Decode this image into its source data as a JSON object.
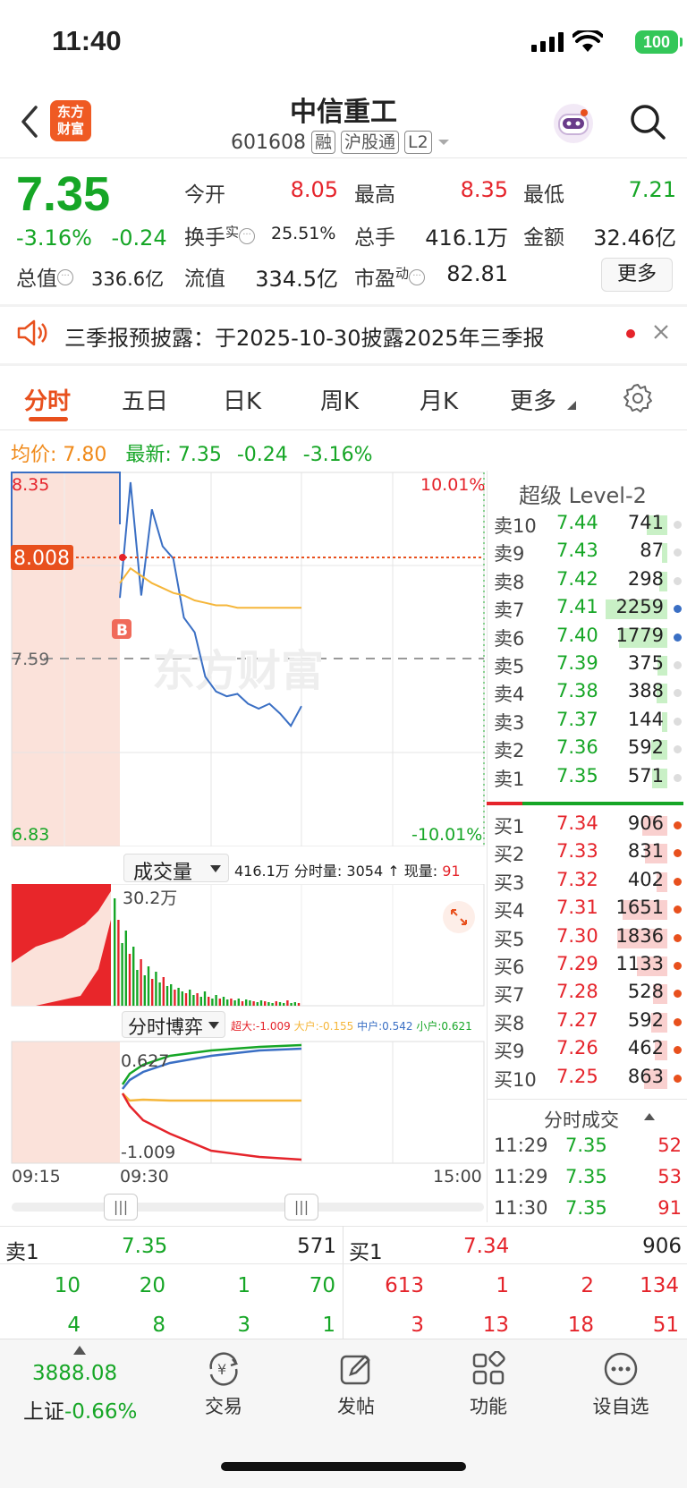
{
  "status": {
    "time": "11:40",
    "battery": "100"
  },
  "header": {
    "logo": "东方\n财富",
    "title": "中信重工",
    "code": "601608",
    "tags": [
      "融",
      "沪股通",
      "L2"
    ]
  },
  "quote": {
    "price": "7.35",
    "change_pct": "-3.16%",
    "change": "-0.24",
    "open_label": "今开",
    "open": "8.05",
    "high_label": "最高",
    "high": "8.35",
    "low_label": "最低",
    "low": "7.21",
    "turnover_label": "换手",
    "turnover_sup": "实",
    "turnover": "25.51%",
    "volume_label": "总手",
    "volume": "416.1万",
    "amount_label": "金额",
    "amount": "32.46亿",
    "mktcap_label": "总值",
    "mktcap": "336.6亿",
    "float_label": "流值",
    "float": "334.5亿",
    "pe_label": "市盈",
    "pe_sup": "动",
    "pe": "82.81",
    "more": "更多"
  },
  "notice": {
    "text": "三季报预披露：于2025-10-30披露2025年三季报"
  },
  "tabs": [
    "分时",
    "五日",
    "日K",
    "周K",
    "月K",
    "更多"
  ],
  "chart_info": {
    "avg_label": "均价:",
    "avg": "7.80",
    "latest_label": "最新:",
    "latest": "7.35",
    "chg": "-0.24",
    "pct": "-3.16%"
  },
  "chart_data": {
    "type": "line",
    "title": "",
    "y_left_ticks": [
      "8.35",
      "7.59",
      "6.83"
    ],
    "y_right_ticks": [
      "10.01%",
      "-10.01%"
    ],
    "crosshair_price": "8.008",
    "marker": "B",
    "x_ticks": [
      "09:15",
      "09:30",
      "15:00"
    ],
    "watermark": "东方财富",
    "series": [
      {
        "color": "#3a6fc4",
        "values": [
          7.84,
          8.31,
          7.85,
          8.2,
          8.05,
          8.0,
          7.76,
          7.7,
          7.52,
          7.46,
          7.44,
          7.45,
          7.41,
          7.39,
          7.41,
          7.37,
          7.32,
          7.4
        ]
      },
      {
        "color": "#f5b63a",
        "values": [
          7.9,
          7.96,
          7.93,
          7.9,
          7.88,
          7.86,
          7.85,
          7.83,
          7.82,
          7.81,
          7.81,
          7.8,
          7.8,
          7.8,
          7.8,
          7.8,
          7.8,
          7.8
        ]
      }
    ]
  },
  "volume_panel": {
    "label": "成交量",
    "total": "416.1万",
    "tick_label": "分时量:",
    "tick_vol": "3054",
    "now_label": "现量:",
    "now": "91",
    "max_label": "30.2万"
  },
  "game_panel": {
    "label": "分时博弈",
    "big_label": "超大:",
    "big": "-1.009",
    "large_label": "大户:",
    "large": "-0.155",
    "mid_label": "中户:",
    "mid": "0.542",
    "small_label": "小户:",
    "small": "0.621",
    "top_val": "0.627",
    "bot_val": "-1.009"
  },
  "level2": {
    "title": "超级 Level-2",
    "asks": [
      {
        "label": "卖10",
        "price": "7.44",
        "vol": "741"
      },
      {
        "label": "卖9",
        "price": "7.43",
        "vol": "87"
      },
      {
        "label": "卖8",
        "price": "7.42",
        "vol": "298"
      },
      {
        "label": "卖7",
        "price": "7.41",
        "vol": "2259"
      },
      {
        "label": "卖6",
        "price": "7.40",
        "vol": "1779"
      },
      {
        "label": "卖5",
        "price": "7.39",
        "vol": "375"
      },
      {
        "label": "卖4",
        "price": "7.38",
        "vol": "388"
      },
      {
        "label": "卖3",
        "price": "7.37",
        "vol": "144"
      },
      {
        "label": "卖2",
        "price": "7.36",
        "vol": "592"
      },
      {
        "label": "卖1",
        "price": "7.35",
        "vol": "571"
      }
    ],
    "bids": [
      {
        "label": "买1",
        "price": "7.34",
        "vol": "906"
      },
      {
        "label": "买2",
        "price": "7.33",
        "vol": "831"
      },
      {
        "label": "买3",
        "price": "7.32",
        "vol": "402"
      },
      {
        "label": "买4",
        "price": "7.31",
        "vol": "1651"
      },
      {
        "label": "买5",
        "price": "7.30",
        "vol": "1836"
      },
      {
        "label": "买6",
        "price": "7.29",
        "vol": "1133"
      },
      {
        "label": "买7",
        "price": "7.28",
        "vol": "528"
      },
      {
        "label": "买8",
        "price": "7.27",
        "vol": "592"
      },
      {
        "label": "买9",
        "price": "7.26",
        "vol": "462"
      },
      {
        "label": "买10",
        "price": "7.25",
        "vol": "863"
      }
    ],
    "ticks_title": "分时成交",
    "ticks": [
      {
        "time": "11:29",
        "price": "7.35",
        "vol": "52"
      },
      {
        "time": "11:29",
        "price": "7.35",
        "vol": "53"
      },
      {
        "time": "11:30",
        "price": "7.35",
        "vol": "91"
      }
    ]
  },
  "bottom_quotes": {
    "ask1_label": "卖1",
    "ask1_price": "7.35",
    "ask1_vol": "571",
    "bid1_label": "买1",
    "bid1_price": "7.34",
    "bid1_vol": "906",
    "ask_orders_row1": [
      "10",
      "20",
      "1",
      "70"
    ],
    "ask_orders_row2": [
      "4",
      "8",
      "3",
      "1"
    ],
    "bid_orders_row1": [
      "613",
      "1",
      "2",
      "134"
    ],
    "bid_orders_row2": [
      "3",
      "13",
      "18",
      "51"
    ]
  },
  "index": {
    "value": "3888.08",
    "name": "上证",
    "pct": "-0.66%"
  },
  "bottom_tabs": [
    "交易",
    "发帖",
    "功能",
    "设自选"
  ]
}
